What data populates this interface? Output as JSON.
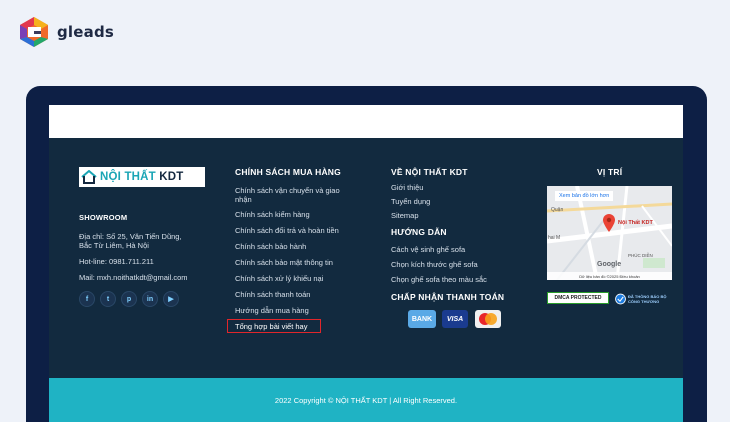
{
  "brand": {
    "name": "gleads"
  },
  "footer": {
    "logo_prefix": "NỘI THẤT ",
    "logo_suffix": "KDT",
    "showroom": {
      "title": "SHOWROOM",
      "address_line1": "Địa chỉ: Số 25, Văn Tiến Dũng,",
      "address_line2": "Bắc Từ Liêm, Hà Nội",
      "hotline": "Hot-line: 0981.711.211",
      "mail": "Mail: mxh.noithatkdt@gmail.com"
    },
    "social": [
      {
        "icon": "facebook-icon",
        "glyph": "f"
      },
      {
        "icon": "twitter-icon",
        "glyph": "t"
      },
      {
        "icon": "pinterest-icon",
        "glyph": "p"
      },
      {
        "icon": "linkedin-icon",
        "glyph": "in"
      },
      {
        "icon": "twitch-icon",
        "glyph": "▶"
      }
    ],
    "policy": {
      "title": "CHÍNH SÁCH MUA HÀNG",
      "items": [
        "Chính sách vận chuyển và giao",
        "nhận",
        "Chính sách kiểm hàng",
        "Chính sách đổi trả và hoàn tiền",
        "Chính sách bảo hành",
        "Chính sách bảo mật thông tin",
        "Chính sách xử lý khiếu nại",
        "Chính sách thanh toán",
        "Hướng dẫn mua hàng",
        "Tổng hợp bài viết hay"
      ]
    },
    "about": {
      "title": "VỀ NỘI THẤT KDT",
      "items": [
        "Giới thiệu",
        "Tuyển dụng",
        "Sitemap"
      ]
    },
    "guide": {
      "title": "HƯỚNG DẪN",
      "items": [
        "Cách vệ sinh ghế sofa",
        "Chọn kích thước ghế sofa",
        "Chọn ghế sofa theo màu sắc"
      ]
    },
    "payment": {
      "title": "CHẤP NHẬN THANH TOÁN",
      "methods": [
        "BANK",
        "VISA",
        "MasterCard"
      ]
    },
    "location": {
      "title": "VỊ TRÍ",
      "map_link": "Xem bản đồ lớn hơn",
      "pin_label": "Nội Thất KDT",
      "area1": "Quận",
      "area2": "PHÚC DIỄN",
      "area3": "hai M",
      "google": "Google",
      "map_footer": "Dữ liệu bản đồ ©2025   Điều khoản"
    },
    "badges": {
      "dmca": "DMCA PROTECTED",
      "bct": "ĐÃ THÔNG BÁO BỘ CÔNG THƯƠNG"
    },
    "copyright": "2022 Copyright © NỘI THẤT KDT | All Right Reserved."
  },
  "colors": {
    "footer_bg": "#122a3f",
    "accent": "#1fb3c4",
    "frame": "#0d1f45"
  }
}
